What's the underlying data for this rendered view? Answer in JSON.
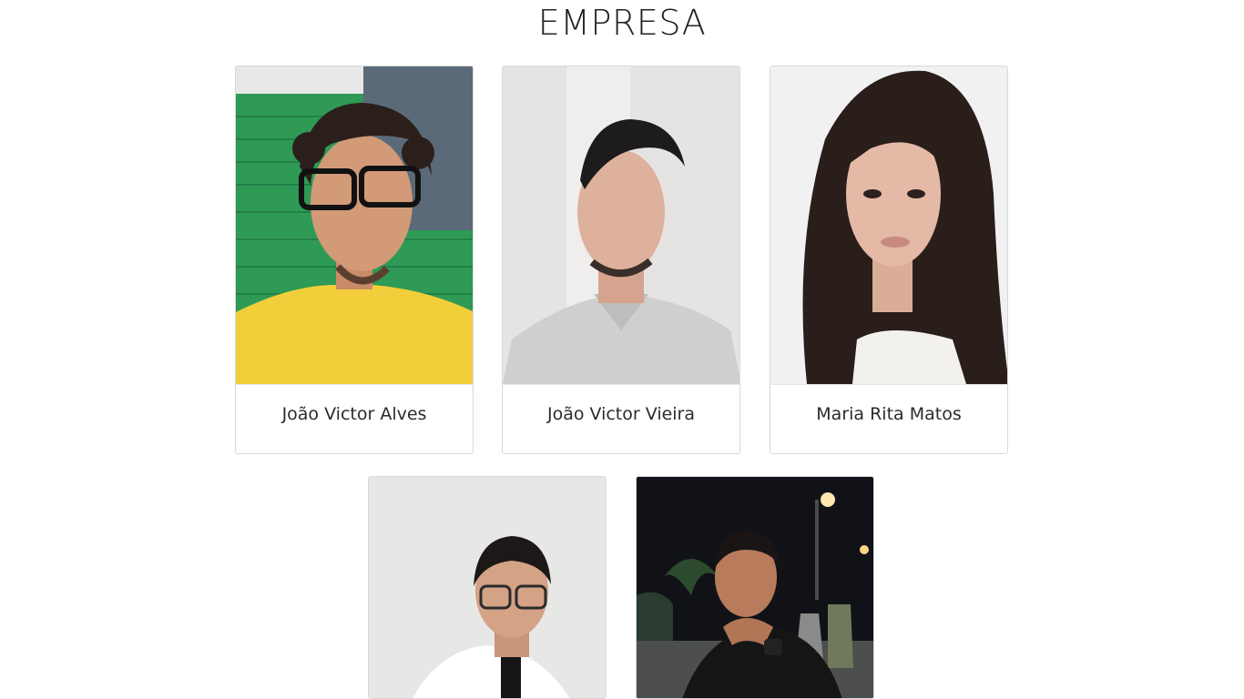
{
  "page": {
    "title": "EMPRESA"
  },
  "members": [
    {
      "name": "João Victor Alves"
    },
    {
      "name": "João Victor Vieira"
    },
    {
      "name": "Maria Rita Matos"
    },
    {
      "name": ""
    },
    {
      "name": ""
    }
  ]
}
